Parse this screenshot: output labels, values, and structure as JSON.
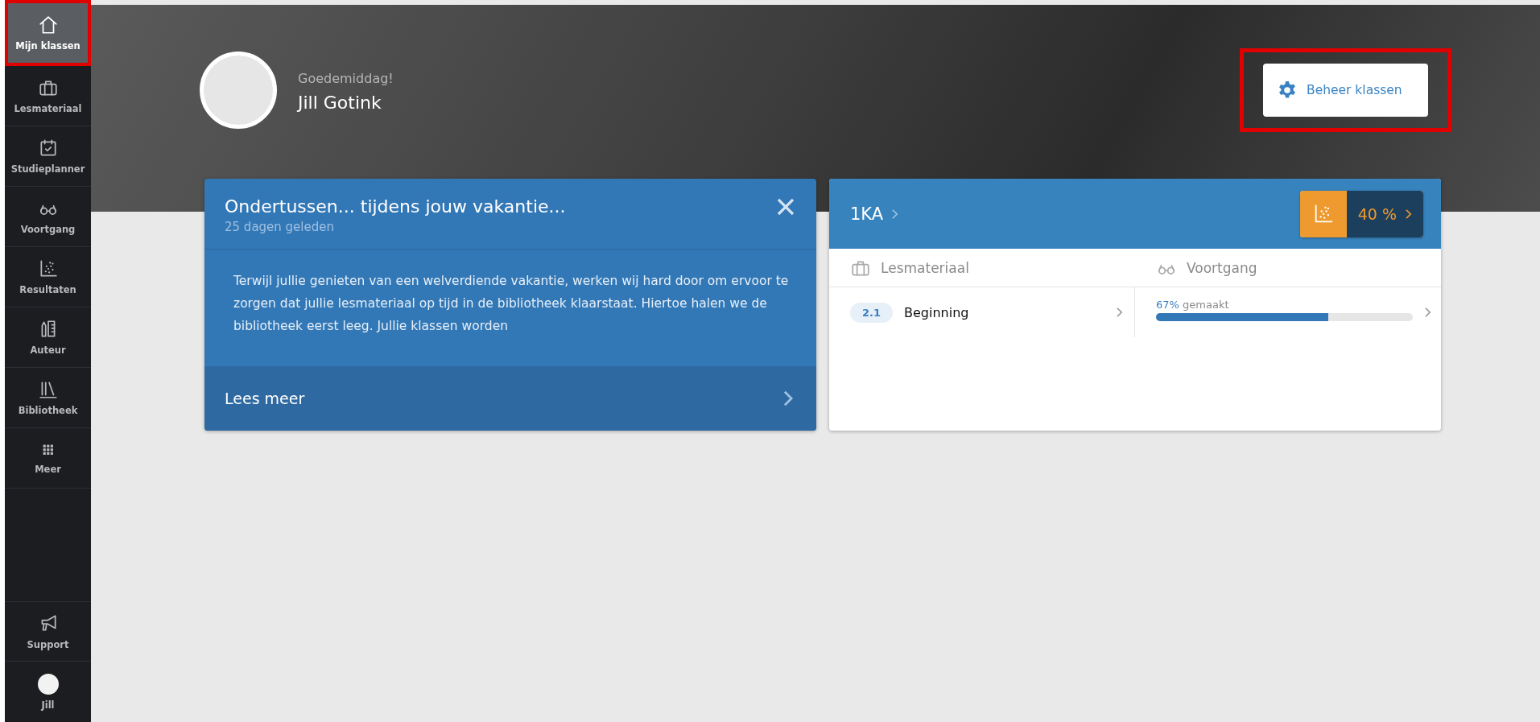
{
  "sidebar": {
    "items": [
      {
        "label": "Mijn klassen",
        "selected": true,
        "highlighted": true
      },
      {
        "label": "Lesmateriaal",
        "selected": false,
        "highlighted": false
      },
      {
        "label": "Studieplanner",
        "selected": false,
        "highlighted": false
      },
      {
        "label": "Voortgang",
        "selected": false,
        "highlighted": false
      },
      {
        "label": "Resultaten",
        "selected": false,
        "highlighted": false
      },
      {
        "label": "Auteur",
        "selected": false,
        "highlighted": false
      },
      {
        "label": "Bibliotheek",
        "selected": false,
        "highlighted": false
      },
      {
        "label": "Meer",
        "selected": false,
        "highlighted": false
      }
    ],
    "support": {
      "label": "Support"
    },
    "user": {
      "label": "Jill"
    }
  },
  "header": {
    "greeting": "Goedemiddag!",
    "name": "Jill Gotink",
    "manage_button": {
      "label": "Beheer klassen",
      "highlighted": true
    }
  },
  "notice": {
    "title": "Ondertussen... tijdens jouw vakantie...",
    "age": "25 dagen geleden",
    "body": "Terwijl jullie genieten van een welverdiende vakantie, werken wij hard door om ervoor te zorgen dat jullie lesmateriaal op tijd in de bibliotheek klaarstaat. Hiertoe halen we de bibliotheek eerst leeg. Jullie klassen worden",
    "read_more": "Lees meer"
  },
  "class_card": {
    "name": "1KA",
    "score": "40 %",
    "columns": [
      "Lesmateriaal",
      "Voortgang"
    ],
    "material": {
      "chapter": "2.1",
      "title": "Beginning"
    },
    "progress": {
      "percent": "67%",
      "label": "gemaakt",
      "level": 0.67
    }
  }
}
